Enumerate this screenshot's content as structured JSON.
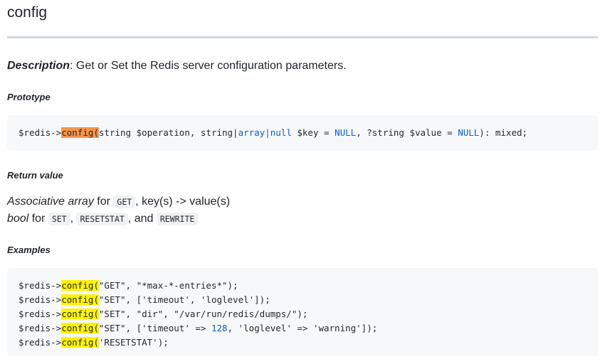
{
  "page_title": "config",
  "description": {
    "label": "Description",
    "text": ": Get or Set the Redis server configuration parameters."
  },
  "prototype": {
    "heading": "Prototype",
    "pre": "$redis->",
    "fn": "config(",
    "args_1": "string $operation, string|",
    "kw_array": "array",
    "sep": "|",
    "kw_null": "null",
    "args_2": " $key = ",
    "kw_NULL_1": "NULL",
    "args_3": ", ?string $value = ",
    "kw_NULL_2": "NULL",
    "args_4": "): mixed;"
  },
  "return_value": {
    "heading": "Return value",
    "line1_em": "Associative array",
    "line1_for": " for ",
    "line1_code": "GET",
    "line1_rest": ", key(s) -> value(s)",
    "line2_em": "bool",
    "line2_for": " for ",
    "line2_code1": "SET",
    "line2_comma": ", ",
    "line2_code2": "RESETSTAT",
    "line2_and": ", and ",
    "line2_code3": "REWRITE"
  },
  "examples": {
    "heading": "Examples",
    "pre": "$redis->",
    "fn": "config(",
    "lines": [
      {
        "rest": "\"GET\", \"*max-*-entries*\");"
      },
      {
        "rest": "\"SET\", ['timeout', 'loglevel']);"
      },
      {
        "rest": "\"SET\", \"dir\", \"/var/run/redis/dumps/\");"
      },
      {
        "rest_a": "\"SET\", ['timeout' => ",
        "num": "128",
        "rest_b": ", 'loglevel' => 'warning']);"
      },
      {
        "rest": "'RESETSTAT');"
      }
    ]
  }
}
